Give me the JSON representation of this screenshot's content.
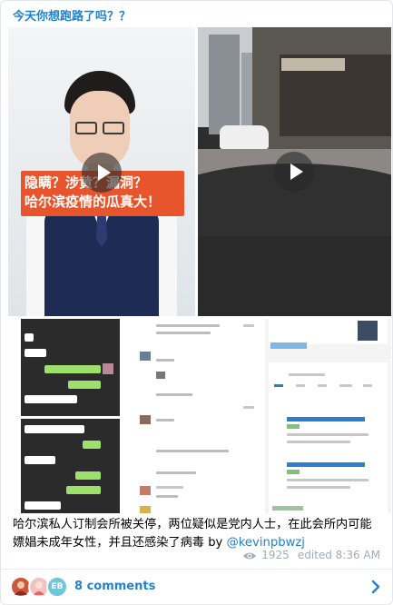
{
  "channel": {
    "title": "今天你想跑路了吗？？"
  },
  "video1": {
    "banner_lines": [
      "隐瞒？涉黄？漏洞？",
      "哈尔滨疫情的瓜真大！"
    ]
  },
  "screens": {
    "chat_top": [
      "对",
      "未成年",
      "十五六未成年呢 不就是孩子么",
      "未成年 这查就不小",
      "你长啥了他们的心都有了"
    ],
    "chat_bottom": [
      "有四个姑娘这个，找到事立案了",
      "为啥？",
      "隐瞒按禁史",
      "隐瞒了吗？",
      "不查查出来了吗",
      "国内没有主动汇报"
    ],
    "forum": {
      "heading": "私人订制内部哈哈小姐姐",
      "items": [
        "视频",
        "听说梁老陈的张斌",
        "视频",
        "私人订制的小姐姐质量还真不错",
        "800起，出台2000起"
      ],
      "last_user": "快 5 天",
      "last_text": "包夜那"
    },
    "company": {
      "code": "12345678 1919",
      "tabs": [
        "公司",
        "老板",
        "风险",
        "股东信息",
        "商标"
      ],
      "entries": [
        "呼伦贝尔市哈哈娱乐服务有限公司",
        "呼伦贝尔市哈哈餐饮管理有限公司"
      ]
    }
  },
  "caption": {
    "text": "哈尔滨私人订制会所被关停，两位疑似是党内人士，在此会所内可能嫖娼未成年女性，并且还感染了病毒 by ",
    "mention": "@kevinpbwzj"
  },
  "meta": {
    "views": "1925",
    "edited": "edited 8:36 AM"
  },
  "comments": {
    "label": "8 comments",
    "avatar_initials": "EB"
  },
  "colors": {
    "accent": "#2481cc",
    "banner": "#e8542c",
    "chat_green": "#9ee06c"
  }
}
